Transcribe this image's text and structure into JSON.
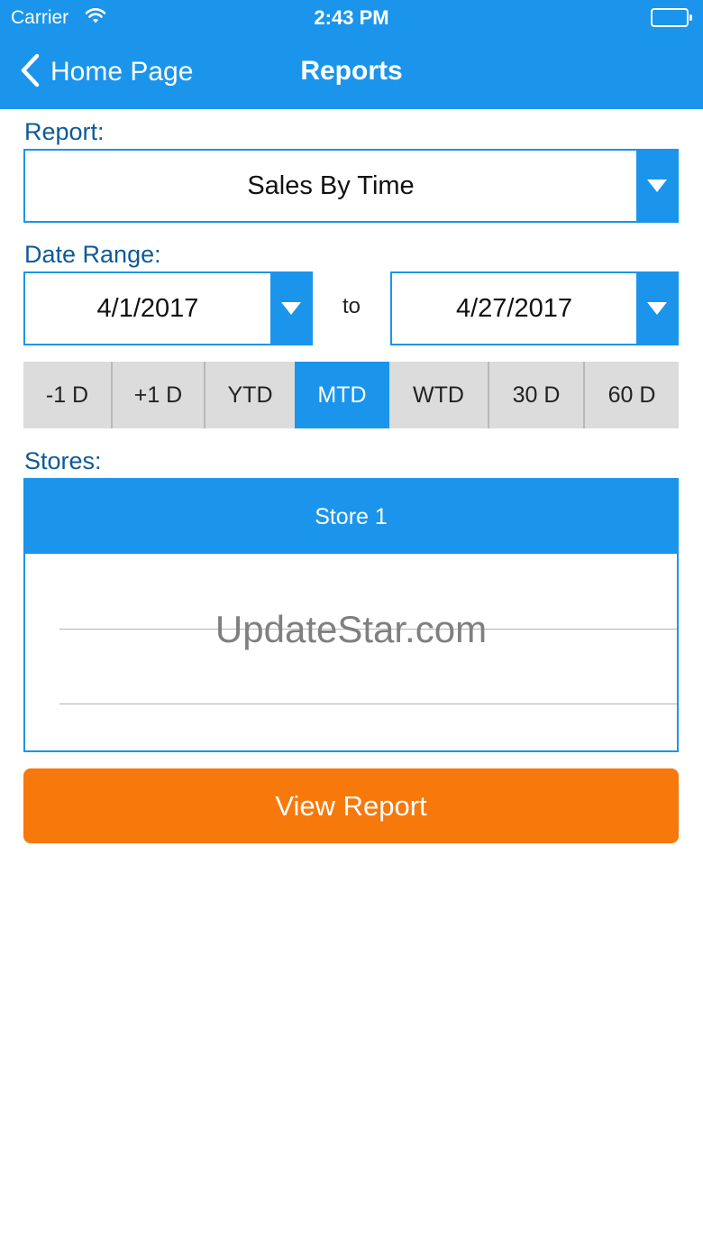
{
  "status_bar": {
    "carrier": "Carrier",
    "time": "2:43 PM"
  },
  "nav": {
    "back_label": "Home Page",
    "title": "Reports"
  },
  "report": {
    "label": "Report:",
    "selected": "Sales By Time"
  },
  "date_range": {
    "label": "Date Range:",
    "from": "4/1/2017",
    "separator": "to",
    "to": "4/27/2017"
  },
  "presets": [
    {
      "label": "-1 D",
      "active": false
    },
    {
      "label": "+1 D",
      "active": false
    },
    {
      "label": "YTD",
      "active": false
    },
    {
      "label": "MTD",
      "active": true
    },
    {
      "label": "WTD",
      "active": false
    },
    {
      "label": "30 D",
      "active": false
    },
    {
      "label": "60 D",
      "active": false
    }
  ],
  "stores": {
    "label": "Stores:",
    "items": [
      "Store 1"
    ],
    "watermark": "UpdateStar.com"
  },
  "actions": {
    "view_report": "View Report"
  },
  "colors": {
    "primary": "#1a95eb",
    "accent": "#f7780b",
    "label_text": "#0e5a96"
  },
  "icons": {
    "back": "chevron-left-icon",
    "dropdown": "triangle-down-icon",
    "wifi": "wifi-icon",
    "battery": "battery-icon"
  }
}
